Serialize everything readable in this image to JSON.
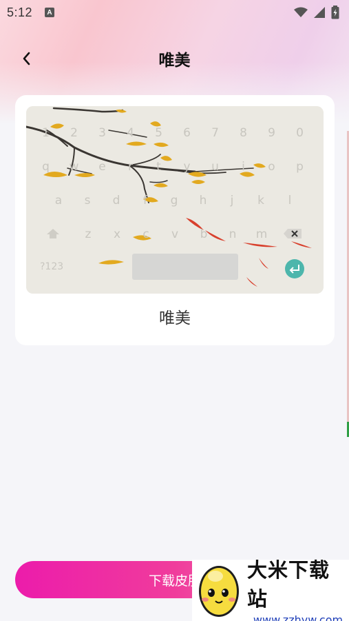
{
  "status_bar": {
    "time": "5:12",
    "a_icon_text": "A",
    "icons": [
      "text-a-icon",
      "wifi-icon",
      "signal-icon",
      "battery-charging-icon"
    ]
  },
  "header": {
    "title": "唯美",
    "back_icon": "chevron-left-icon"
  },
  "skin_card": {
    "name": "唯美",
    "keyboard_preview": {
      "row1": [
        "1",
        "2",
        "3",
        "4",
        "5",
        "6",
        "7",
        "8",
        "9",
        "0"
      ],
      "row2": [
        "q",
        "w",
        "e",
        "r",
        "t",
        "y",
        "u",
        "i",
        "o",
        "p"
      ],
      "row3": [
        "a",
        "s",
        "d",
        "f",
        "g",
        "h",
        "j",
        "k",
        "l"
      ],
      "row4": [
        "z",
        "x",
        "c",
        "v",
        "b",
        "n",
        "m"
      ],
      "symbols_key": "?123",
      "icons": [
        "shift-icon",
        "backspace-icon",
        "enter-icon"
      ]
    }
  },
  "download_button": {
    "label": "下载皮肤"
  },
  "watermark": {
    "title": "大米下载站",
    "url": "www.zzhyw.com",
    "logo_icon": "egg-mascot-icon"
  },
  "colors": {
    "accent_start": "#ec1cab",
    "accent_end": "#f28ab4",
    "enter_key": "#4db6ac",
    "watermark_url": "#1f3fb8"
  }
}
